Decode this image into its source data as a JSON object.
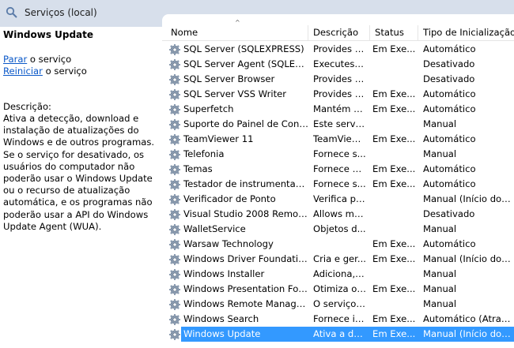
{
  "window": {
    "title": "Serviços (local)"
  },
  "details": {
    "service_name": "Windows Update",
    "actions": [
      {
        "link": "Parar",
        "rest": " o serviço"
      },
      {
        "link": "Reiniciar",
        "rest": " o serviço"
      }
    ],
    "description_label": "Descrição:",
    "description": "Ativa a detecção, download e instalação de atualizações do Windows e de outros programas. Se o serviço for desativado, os usuários do computador não poderão usar o Windows Update ou o recurso de atualização automática, e os programas não poderão usar a API do Windows Update Agent (WUA)."
  },
  "columns": {
    "name": "Nome",
    "description": "Descrição",
    "status": "Status",
    "startup": "Tipo de Inicialização"
  },
  "services": [
    {
      "name": "SQL Server (SQLEXPRESS)",
      "description": "Provides s...",
      "status": "Em Exe...",
      "startup": "Automático"
    },
    {
      "name": "SQL Server Agent (SQLEXPR...",
      "description": "Executes j...",
      "status": "",
      "startup": "Desativado"
    },
    {
      "name": "SQL Server Browser",
      "description": "Provides S...",
      "status": "",
      "startup": "Desativado"
    },
    {
      "name": "SQL Server VSS Writer",
      "description": "Provides th...",
      "status": "Em Exe...",
      "startup": "Automático"
    },
    {
      "name": "Superfetch",
      "description": "Mantém e...",
      "status": "Em Exe...",
      "startup": "Automático"
    },
    {
      "name": "Suporte do Painel de Contr...",
      "description": "Este serviç...",
      "status": "",
      "startup": "Manual"
    },
    {
      "name": "TeamViewer 11",
      "description": "TeamViewer...",
      "status": "Em Exe...",
      "startup": "Automático"
    },
    {
      "name": "Telefonia",
      "description": "Fornece s...",
      "status": "",
      "startup": "Manual"
    },
    {
      "name": "Temas",
      "description": "Fornece g...",
      "status": "Em Exe...",
      "startup": "Automático"
    },
    {
      "name": "Testador de instrumentação...",
      "description": "Fornece s...",
      "status": "Em Exe...",
      "startup": "Automático"
    },
    {
      "name": "Verificador de Ponto",
      "description": "Verifica po...",
      "status": "",
      "startup": "Manual (Início do Ga..."
    },
    {
      "name": "Visual Studio 2008 Remote ...",
      "description": "Allows me...",
      "status": "",
      "startup": "Desativado"
    },
    {
      "name": "WalletService",
      "description": "Objetos d...",
      "status": "",
      "startup": "Manual"
    },
    {
      "name": "Warsaw Technology",
      "description": "",
      "status": "Em Exe...",
      "startup": "Automático"
    },
    {
      "name": "Windows Driver Foundation...",
      "description": "Cria e ger...",
      "status": "Em Exe...",
      "startup": "Manual (Início do Ga..."
    },
    {
      "name": "Windows Installer",
      "description": "Adiciona, ...",
      "status": "",
      "startup": "Manual"
    },
    {
      "name": "Windows Presentation Fou...",
      "description": "Otimiza o ...",
      "status": "Em Exe...",
      "startup": "Manual"
    },
    {
      "name": "Windows Remote Manage...",
      "description": "O serviço ...",
      "status": "",
      "startup": "Manual"
    },
    {
      "name": "Windows Search",
      "description": "Fornece in...",
      "status": "Em Exe...",
      "startup": "Automático (Atraso ..."
    },
    {
      "name": "Windows Update",
      "description": "Ativa a de...",
      "status": "Em Exe...",
      "startup": "Manual (Início do Ga...",
      "selected": true
    }
  ],
  "colors": {
    "selection": "#3399ff",
    "link": "#0a58c8",
    "titlebar": "#d7dfeb"
  }
}
